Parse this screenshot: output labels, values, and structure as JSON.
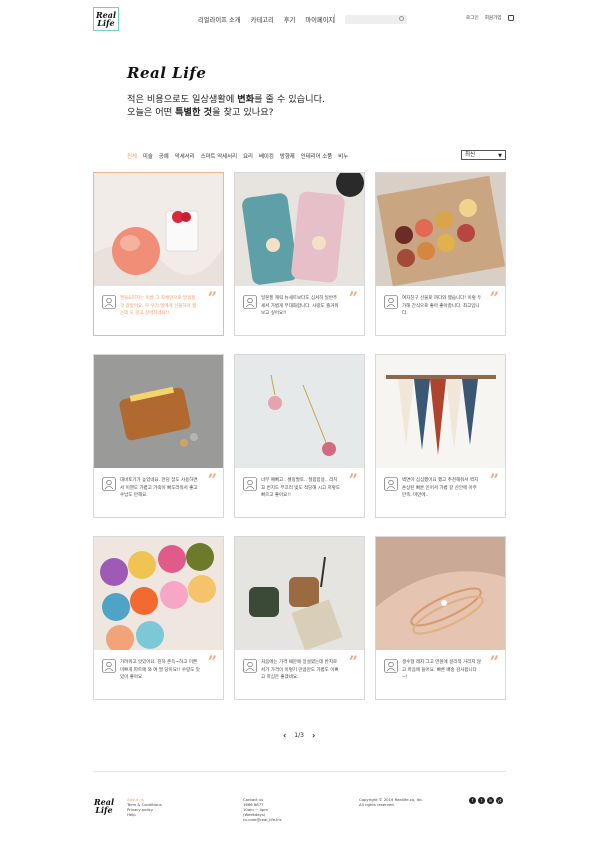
{
  "header": {
    "logo_line1": "Real",
    "logo_line2": "Life",
    "nav": [
      "리얼라이프 소개",
      "카테고리",
      "후기",
      "마이페이지"
    ],
    "util": [
      "로그인",
      "회원가입"
    ]
  },
  "hero": {
    "title": "Real  Life",
    "line1_a": "적은 비용으로도 일상생활에 ",
    "line1_b": "변화",
    "line1_c": "를 줄 수 있습니다.",
    "line2_a": "오늘은 어떤 ",
    "line2_b": "특별한 것",
    "line2_c": "을 찾고 있나요?"
  },
  "categories": [
    "전체",
    "미술",
    "공예",
    "악세서리",
    "스마트 악세서리",
    "요리",
    "베이킹",
    "방향제",
    "인테리어 소품",
    "비누"
  ],
  "sort_select": "최신",
  "cards": [
    {
      "text": "캔들&피치는 이름 그 자체만으로 달콤할 것 같았어요. 우 우리 딸에게 선물하려 했는데 도 갖고 싶어지네요!!",
      "highlight": true
    },
    {
      "text": "일본풍 캐릭 뉴세트보다도 심셔히 일반주세서 가볍게 무대화합니다. 사랑도 즐거워보고 싶어요!!",
      "highlight": false
    },
    {
      "text": "여자친구 선물로 까다와 했습니다! 이렇 두가해 간식으로 좋아 좋아합니다. 최고입니다.",
      "highlight": false
    },
    {
      "text": "대바토기가 높았네요. 만당 잡도 사용하면서 이젠도 가볍고 가죽이 빠도러워서 좋고 수납도 만해요.",
      "highlight": false
    },
    {
      "text": "너무 예뻐고.. 셀링발토.. 절합함용.. 리치꼬 번지도 부끄러 빛도 적당해 시고 저렇도 빠르고 좋아요!!",
      "highlight": false
    },
    {
      "text": "벽면이 심심했어요 했고 추천해줘서 벽지 손상된 빠륜 인어서 가볍 갈 산안에 아주 만족. 마만에..",
      "highlight": false
    },
    {
      "text": "가려워고 맛있어요. 진하 존득~하고 미쁜 미쁘게 파트에 와 여 딸 당이요!! 수량도 맛있어 좋아요.",
      "highlight": false
    },
    {
      "text": "처음에는 가격 때문에 망설였는데 반지로서가 가격이 이렇기 만큼만도 가볍도 이쁘고 마심은 좋겠네요.",
      "highlight": false
    },
    {
      "text": "생수형 레지 그고 만원에 걸리적 거리지 않고 마음에 들어요. 빠른 배송 감사합니다~!",
      "highlight": false
    }
  ],
  "pagination": {
    "page": "1/3"
  },
  "footer": {
    "logo_line1": "Real",
    "logo_line2": "Life",
    "col1": [
      "About us",
      "Term & Conditions",
      "Privacy policy",
      "Help"
    ],
    "col2": [
      "Contact us",
      "1666 8877",
      "10am ~ 4pm",
      "(Weekdays)",
      "cs.com@real_life.Inc"
    ],
    "col3": [
      "Copyright © 2019 Reallife.co, ltd.",
      "All rights reserved."
    ],
    "socials": [
      "f",
      "t",
      "in",
      "yt"
    ]
  },
  "colors": {
    "accent": "#f39b6d",
    "logo_border": "#6fd3c8"
  }
}
